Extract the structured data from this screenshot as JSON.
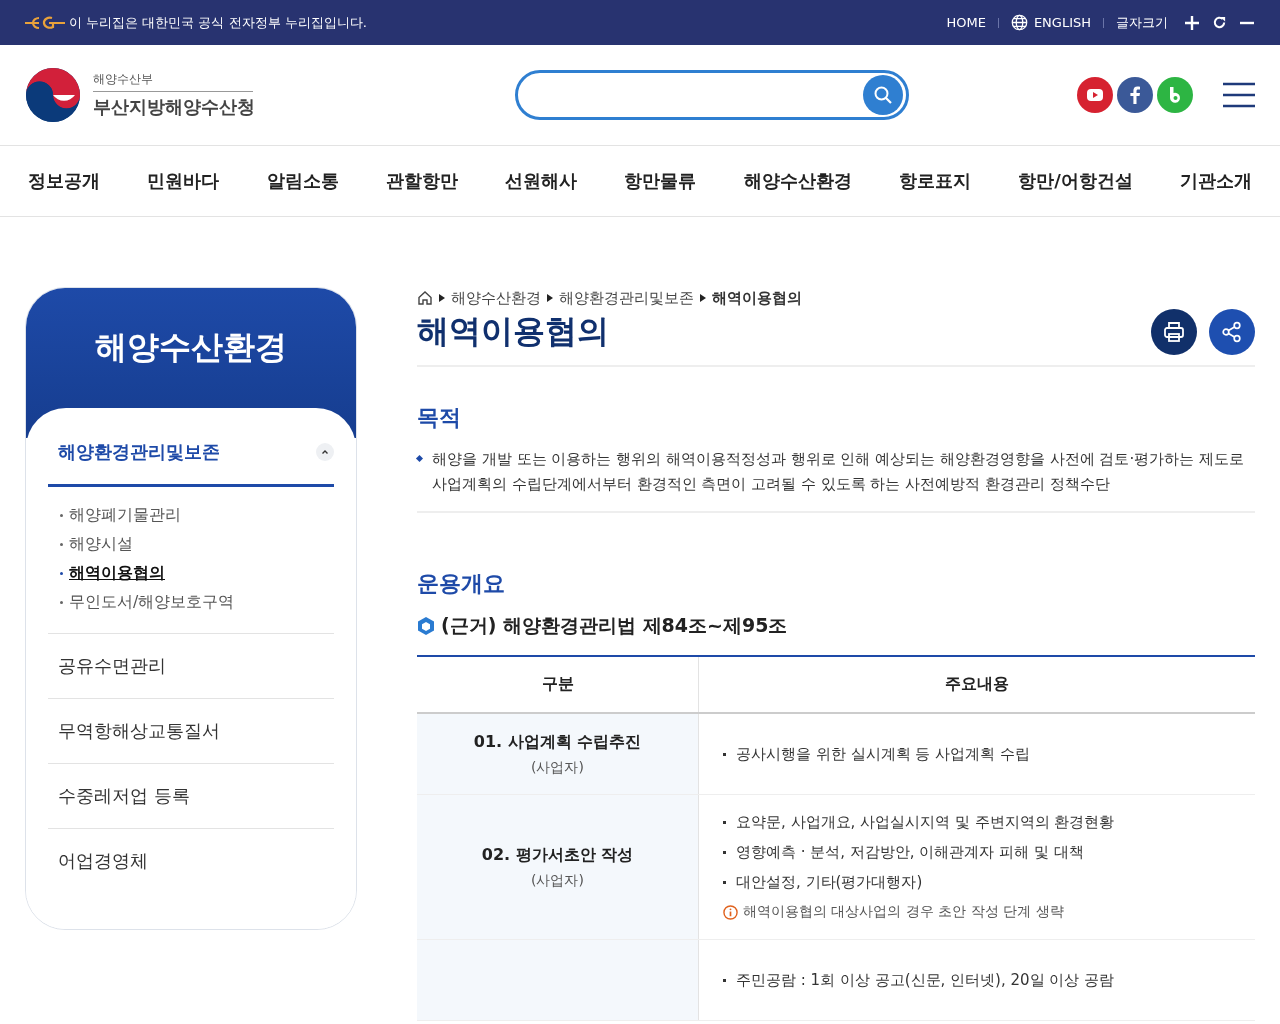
{
  "gov_banner": {
    "text": "이 누리집은 대한민국 공식 전자정부 누리집입니다."
  },
  "utility_links": [
    {
      "label": "HOME",
      "kind": "text"
    },
    {
      "label": "ENGLISH",
      "kind": "globe"
    }
  ],
  "font_size": {
    "label": "글자크기"
  },
  "header": {
    "ministry": "해양수산부",
    "agency": "부산지방해양수산청"
  },
  "nav": [
    {
      "label": "정보공개"
    },
    {
      "label": "민원바다"
    },
    {
      "label": "알림소통"
    },
    {
      "label": "관할항만"
    },
    {
      "label": "선원해사"
    },
    {
      "label": "항만물류"
    },
    {
      "label": "해양수산환경"
    },
    {
      "label": "항로표지"
    },
    {
      "label": "항만/어항건설"
    },
    {
      "label": "기관소개"
    }
  ],
  "sidebar": {
    "title": "해양수산환경",
    "groups": [
      {
        "label": "해양환경관리및보존",
        "expanded": true,
        "children": [
          {
            "label": "해양폐기물관리",
            "selected": false
          },
          {
            "label": "해양시설",
            "selected": false
          },
          {
            "label": "해역이용협의",
            "selected": true
          },
          {
            "label": "무인도서/해양보호구역",
            "selected": false
          }
        ]
      },
      {
        "label": "공유수면관리",
        "expanded": false
      },
      {
        "label": "무역항해상교통질서",
        "expanded": false
      },
      {
        "label": "수중레저업 등록",
        "expanded": false
      },
      {
        "label": "어업경영체",
        "expanded": false
      }
    ]
  },
  "breadcrumb": [
    "해양수산환경",
    "해양환경관리및보존",
    "해역이용협의"
  ],
  "page_title": "해역이용협의",
  "purpose": {
    "heading": "목적",
    "bullets": [
      "해양을 개발 또는 이용하는 행위의 해역이용적정성과 행위로 인해 예상되는 해양환경영향을 사전에 검토·평가하는 제도로 사업계획의 수립단계에서부터 환경적인 측면이 고려될 수 있도록 하는 사전예방적 환경관리 정책수단"
    ]
  },
  "overview": {
    "heading": "운용개요",
    "basis": "(근거) 해양환경관리법 제84조~제95조",
    "table": {
      "columns": [
        "구분",
        "주요내용"
      ],
      "rows": [
        {
          "step": "01. 사업계획 수립추진",
          "actor": "(사업자)",
          "items": [
            {
              "kind": "bullet",
              "text": "공사시행을 위한 실시계획 등 사업계획 수립"
            }
          ]
        },
        {
          "step": "02. 평가서초안 작성",
          "actor": "(사업자)",
          "items": [
            {
              "kind": "bullet",
              "text": "요약문, 사업개요, 사업실시지역 및 주변지역의 환경현황"
            },
            {
              "kind": "bullet",
              "text": "영향예측 · 분석, 저감방안, 이해관계자 피해 및 대책"
            },
            {
              "kind": "bullet",
              "text": "대안설정, 기타(평가대행자)"
            },
            {
              "kind": "note",
              "text": "해역이용협의 대상사업의 경우 초안 작성 단계 생략"
            }
          ]
        },
        {
          "items": [
            {
              "kind": "bullet",
              "text": "주민공람 : 1회 이상 공고(신문, 인터넷), 20일 이상 공람"
            }
          ]
        }
      ]
    }
  }
}
